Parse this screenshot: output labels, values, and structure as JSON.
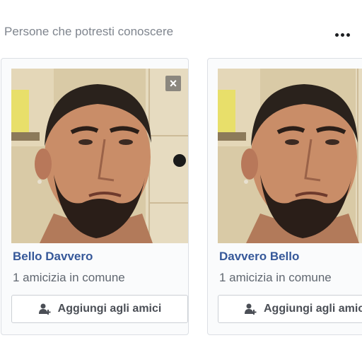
{
  "header": {
    "title": "Persone che potresti conoscere",
    "more_icon": "more-horizontal-icon"
  },
  "cards": [
    {
      "name": "Bello Davvero",
      "mutual": "1 amicizia in comune",
      "add_label": "Aggiungi agli amici",
      "close_icon": "close-icon",
      "add_icon": "add-friend-icon"
    },
    {
      "name": "Davvero Bello",
      "mutual": "1 amicizia in comune",
      "add_label": "Aggiungi agli amici",
      "add_icon": "add-friend-icon"
    }
  ],
  "colors": {
    "name_link": "#365899",
    "secondary_text": "#606770",
    "header_text": "#7f858e",
    "button_text": "#4b4f56"
  }
}
